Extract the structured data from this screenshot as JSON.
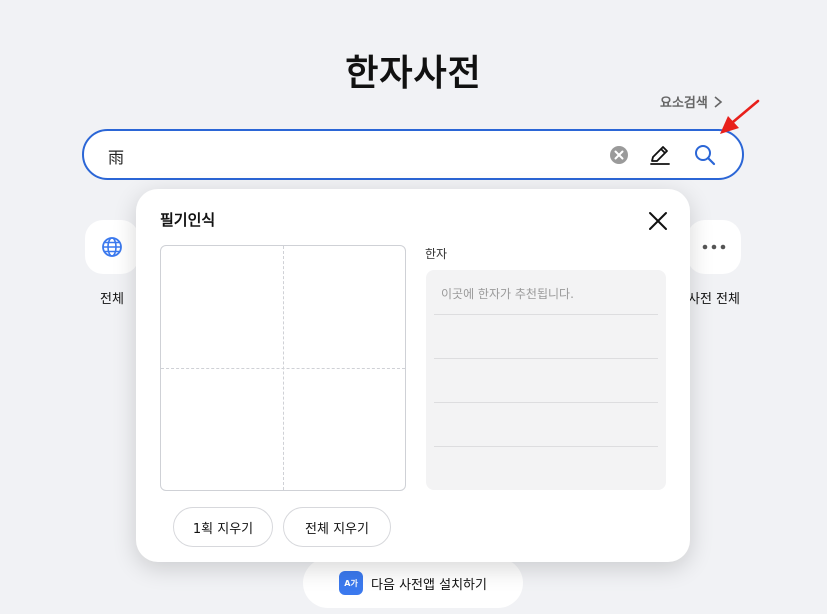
{
  "page": {
    "title": "한자사전"
  },
  "element_search": {
    "label": "요소검색"
  },
  "search": {
    "value": "雨"
  },
  "categories": [
    {
      "label": "전체",
      "icon": "globe-icon"
    },
    {
      "label": "사전 전체",
      "icon": "more-dots-icon"
    }
  ],
  "handwriting_panel": {
    "title": "필기인식",
    "result_label": "한자",
    "result_placeholder": "이곳에 한자가 추천됩니다.",
    "undo_stroke_button": "1획 지우기",
    "clear_all_button": "전체 지우기"
  },
  "install_banner": {
    "icon_text": "A가",
    "label": "다음 사전앱 설치하기"
  },
  "colors": {
    "accent": "#2b66d6",
    "annotation_arrow": "#e8201b",
    "background": "#f1f2f5"
  }
}
